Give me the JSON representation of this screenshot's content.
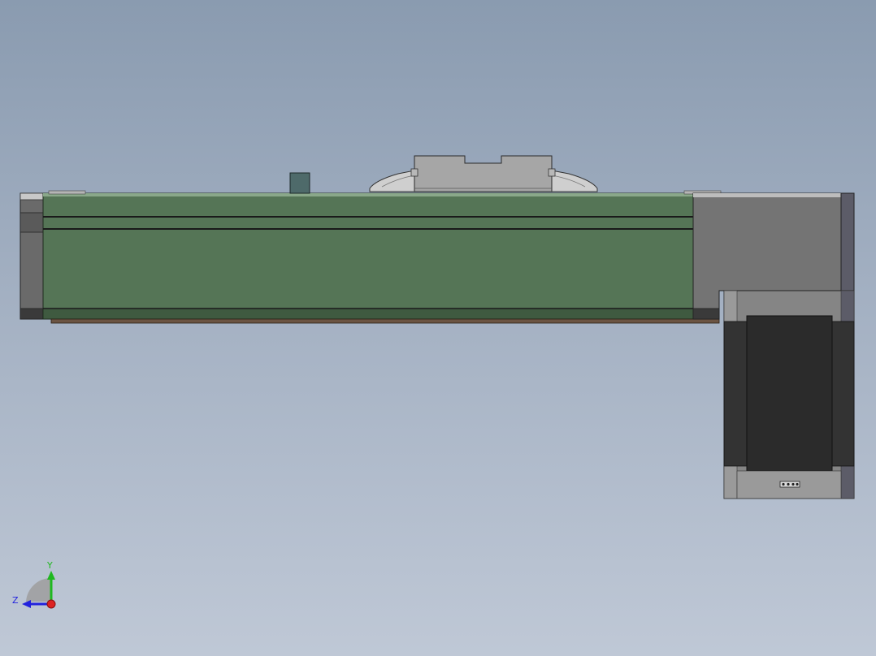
{
  "viewport": {
    "background_top": "#8a9bb0",
    "background_bottom": "#bfc8d6"
  },
  "model": {
    "body_color": "#557556",
    "body_dark": "#2c3a2c",
    "end_cap_color": "#6e6e6e",
    "carriage_color": "#a5a5a5",
    "motor_color": "#2b2b2b",
    "motor_frame_color": "#7a7a7a",
    "base_strip_color": "#6b5443"
  },
  "triad": {
    "y_label": "Y",
    "z_label": "Z",
    "y_color": "#1fb81f",
    "z_color": "#2222dd",
    "x_color": "#dd2222"
  }
}
